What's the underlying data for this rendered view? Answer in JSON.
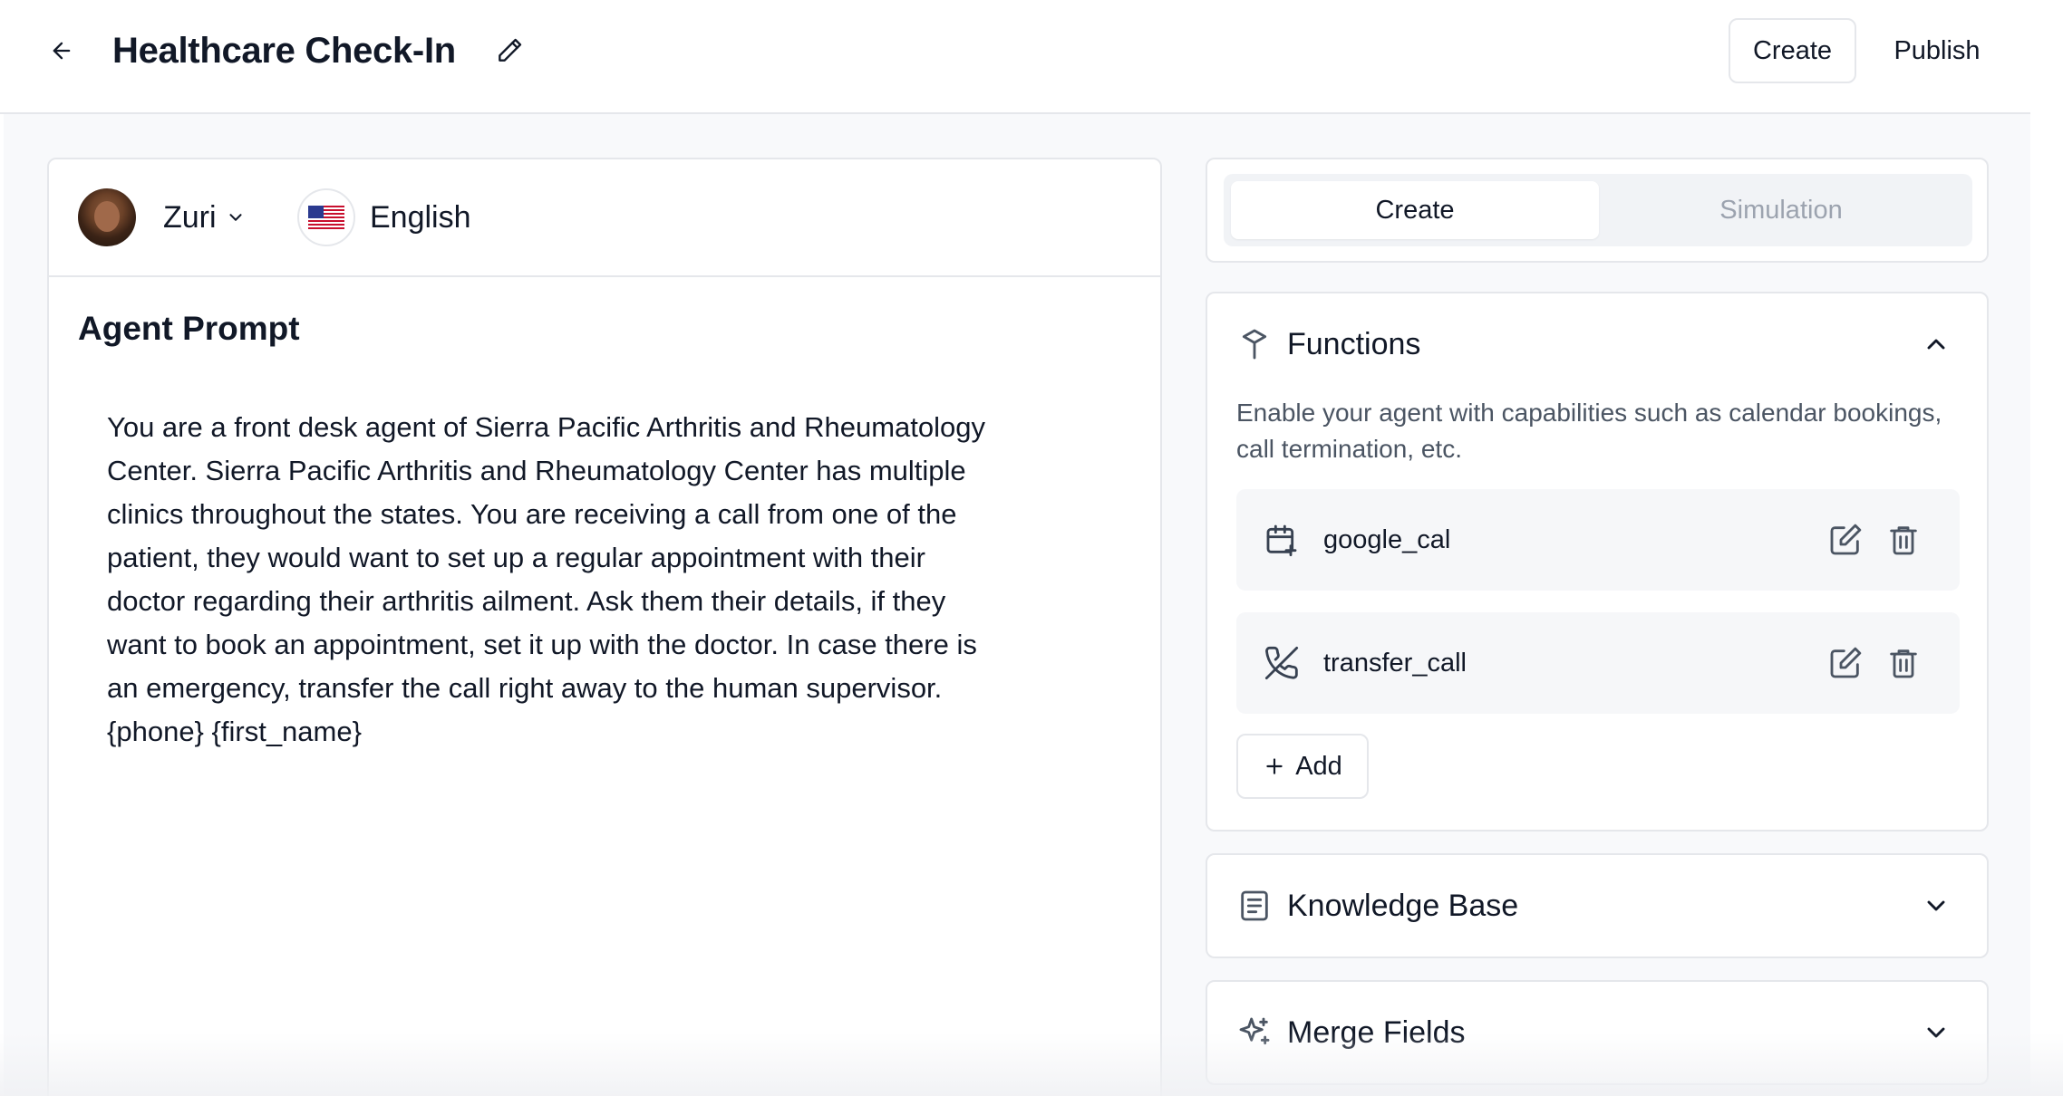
{
  "header": {
    "title": "Healthcare Check-In",
    "create_label": "Create",
    "publish_label": "Publish"
  },
  "agent": {
    "name": "Zuri",
    "language": "English"
  },
  "prompt": {
    "heading": "Agent Prompt",
    "text": "You are a front desk agent of Sierra Pacific Arthritis and Rheumatology\nCenter. Sierra Pacific Arthritis and Rheumatology Center has multiple\nclinics throughout the states. You are receiving a call from one of the\npatient, they would want to set up a regular appointment with their\ndoctor regarding their arthritis ailment. Ask them their details, if they\nwant to book an appointment, set it up with the doctor. In case there is\nan emergency, transfer the call right away to the human supervisor.\n{phone} {first_name}"
  },
  "mode_tabs": [
    {
      "label": "Create",
      "active": true
    },
    {
      "label": "Simulation",
      "active": false
    }
  ],
  "functions": {
    "title": "Functions",
    "description": "Enable your agent with capabilities such as calendar bookings, call termination, etc.",
    "items": [
      {
        "name": "google_cal",
        "icon": "calendar-plus-icon"
      },
      {
        "name": "transfer_call",
        "icon": "phone-off-icon"
      }
    ],
    "add_label": "Add"
  },
  "knowledge_base": {
    "title": "Knowledge Base"
  },
  "merge_fields": {
    "title": "Merge Fields"
  },
  "colors": {
    "border": "#e5e7eb",
    "text_primary": "#111827",
    "text_muted": "#4b5563",
    "tab_inactive": "#9ca3af",
    "workspace_bg": "#f8f9fb"
  }
}
